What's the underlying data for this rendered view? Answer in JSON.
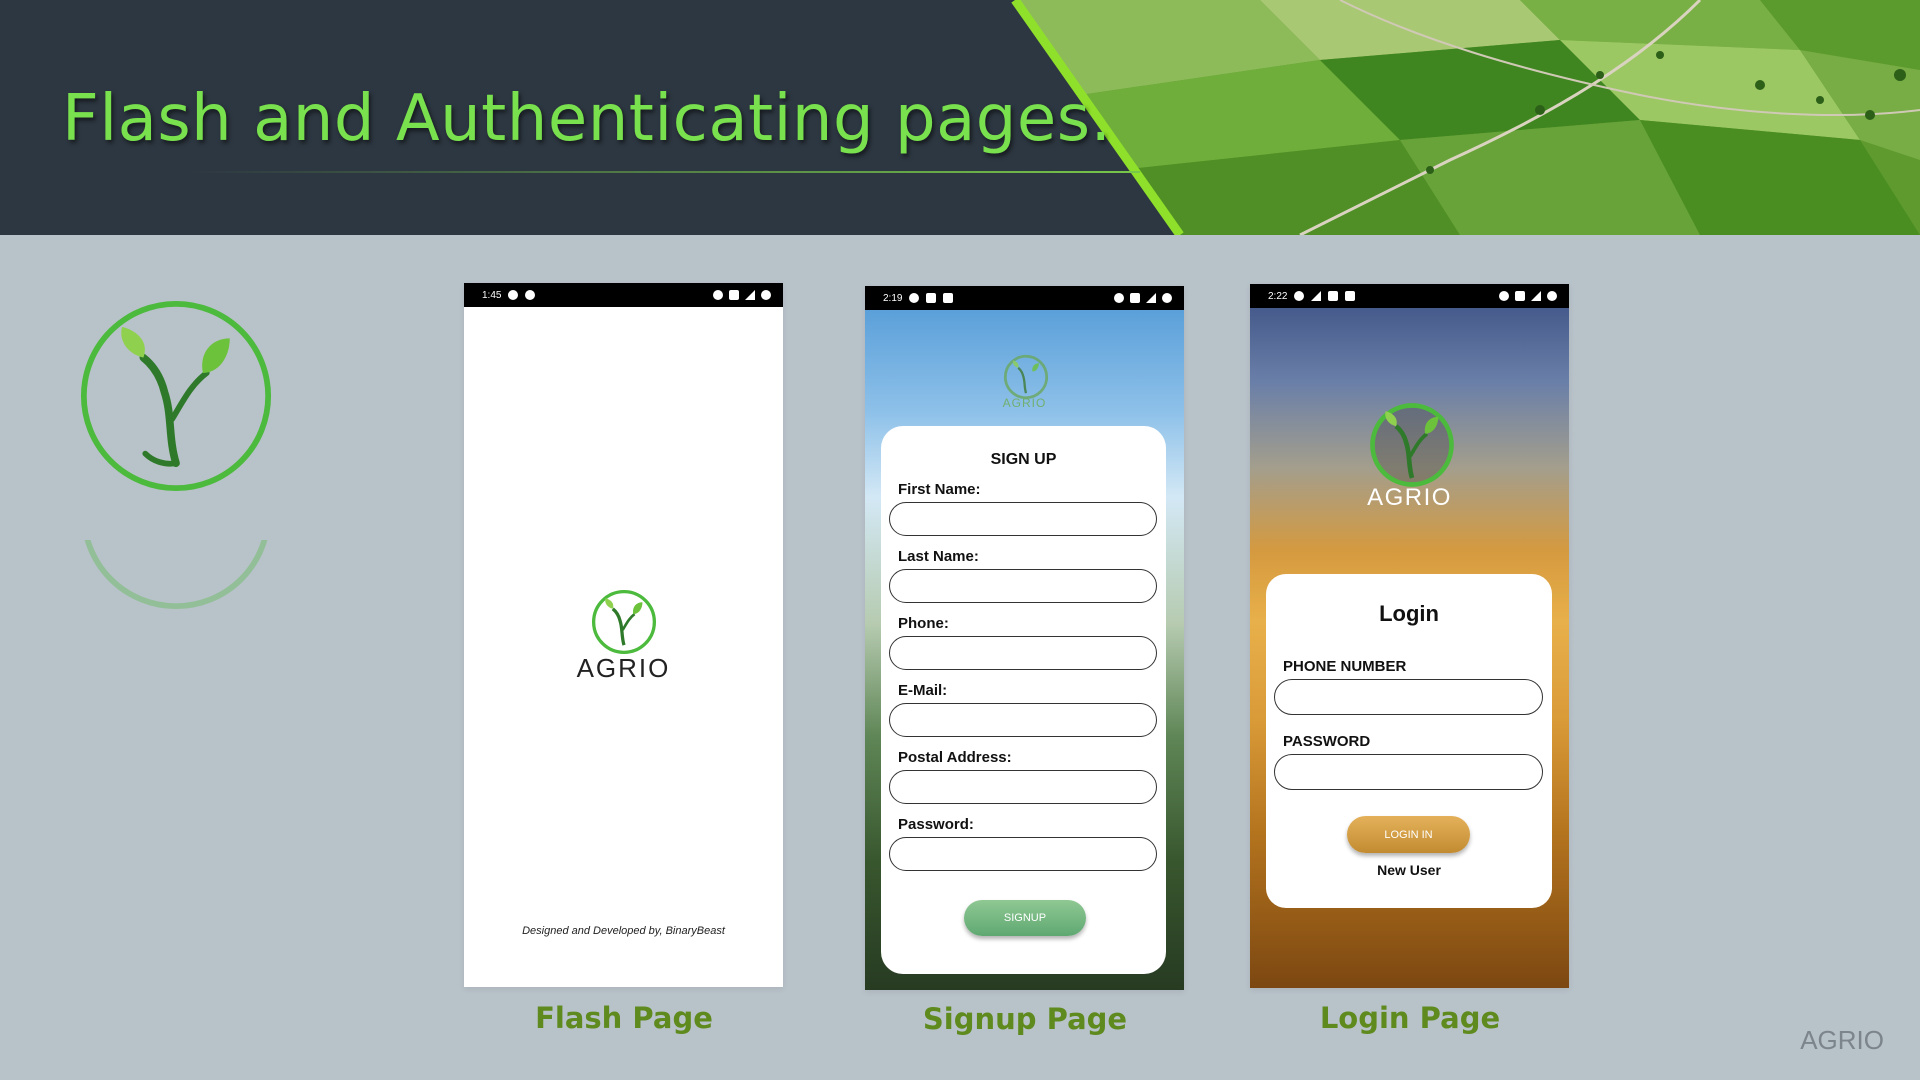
{
  "slide": {
    "title": "Flash and Authenticating pages.",
    "corner_brand": "AGRIO"
  },
  "colors": {
    "header_bg": "#2d3741",
    "title_green": "#79e04e",
    "caption_green": "#5e8a1e",
    "slide_bg": "#b8c2c9",
    "logo_green": "#4cba3c"
  },
  "flash": {
    "status_time": "1:45",
    "app_name": "AGRIO",
    "credit": "Designed and Developed by, BinaryBeast",
    "caption": "Flash Page"
  },
  "signup": {
    "status_time": "2:19",
    "bg_app_name": "AGRIO",
    "title": "SIGN UP",
    "fields": [
      {
        "label": "First Name:",
        "value": ""
      },
      {
        "label": "Last Name:",
        "value": ""
      },
      {
        "label": "Phone:",
        "value": ""
      },
      {
        "label": "E-Mail:",
        "value": ""
      },
      {
        "label": "Postal Address:",
        "value": ""
      },
      {
        "label": "Password:",
        "value": ""
      }
    ],
    "button": "SIGNUP",
    "caption": "Signup Page"
  },
  "login": {
    "status_time": "2:22",
    "app_name": "AGRIO",
    "title": "Login",
    "fields": [
      {
        "label": "PHONE NUMBER",
        "value": ""
      },
      {
        "label": "PASSWORD",
        "value": ""
      }
    ],
    "button": "LOGIN IN",
    "link": "New User",
    "caption": "Login Page"
  },
  "icons": [
    "sprout-logo-icon",
    "notification-icon",
    "wifi-icon",
    "bluetooth-icon",
    "signal-icon",
    "battery-icon"
  ]
}
